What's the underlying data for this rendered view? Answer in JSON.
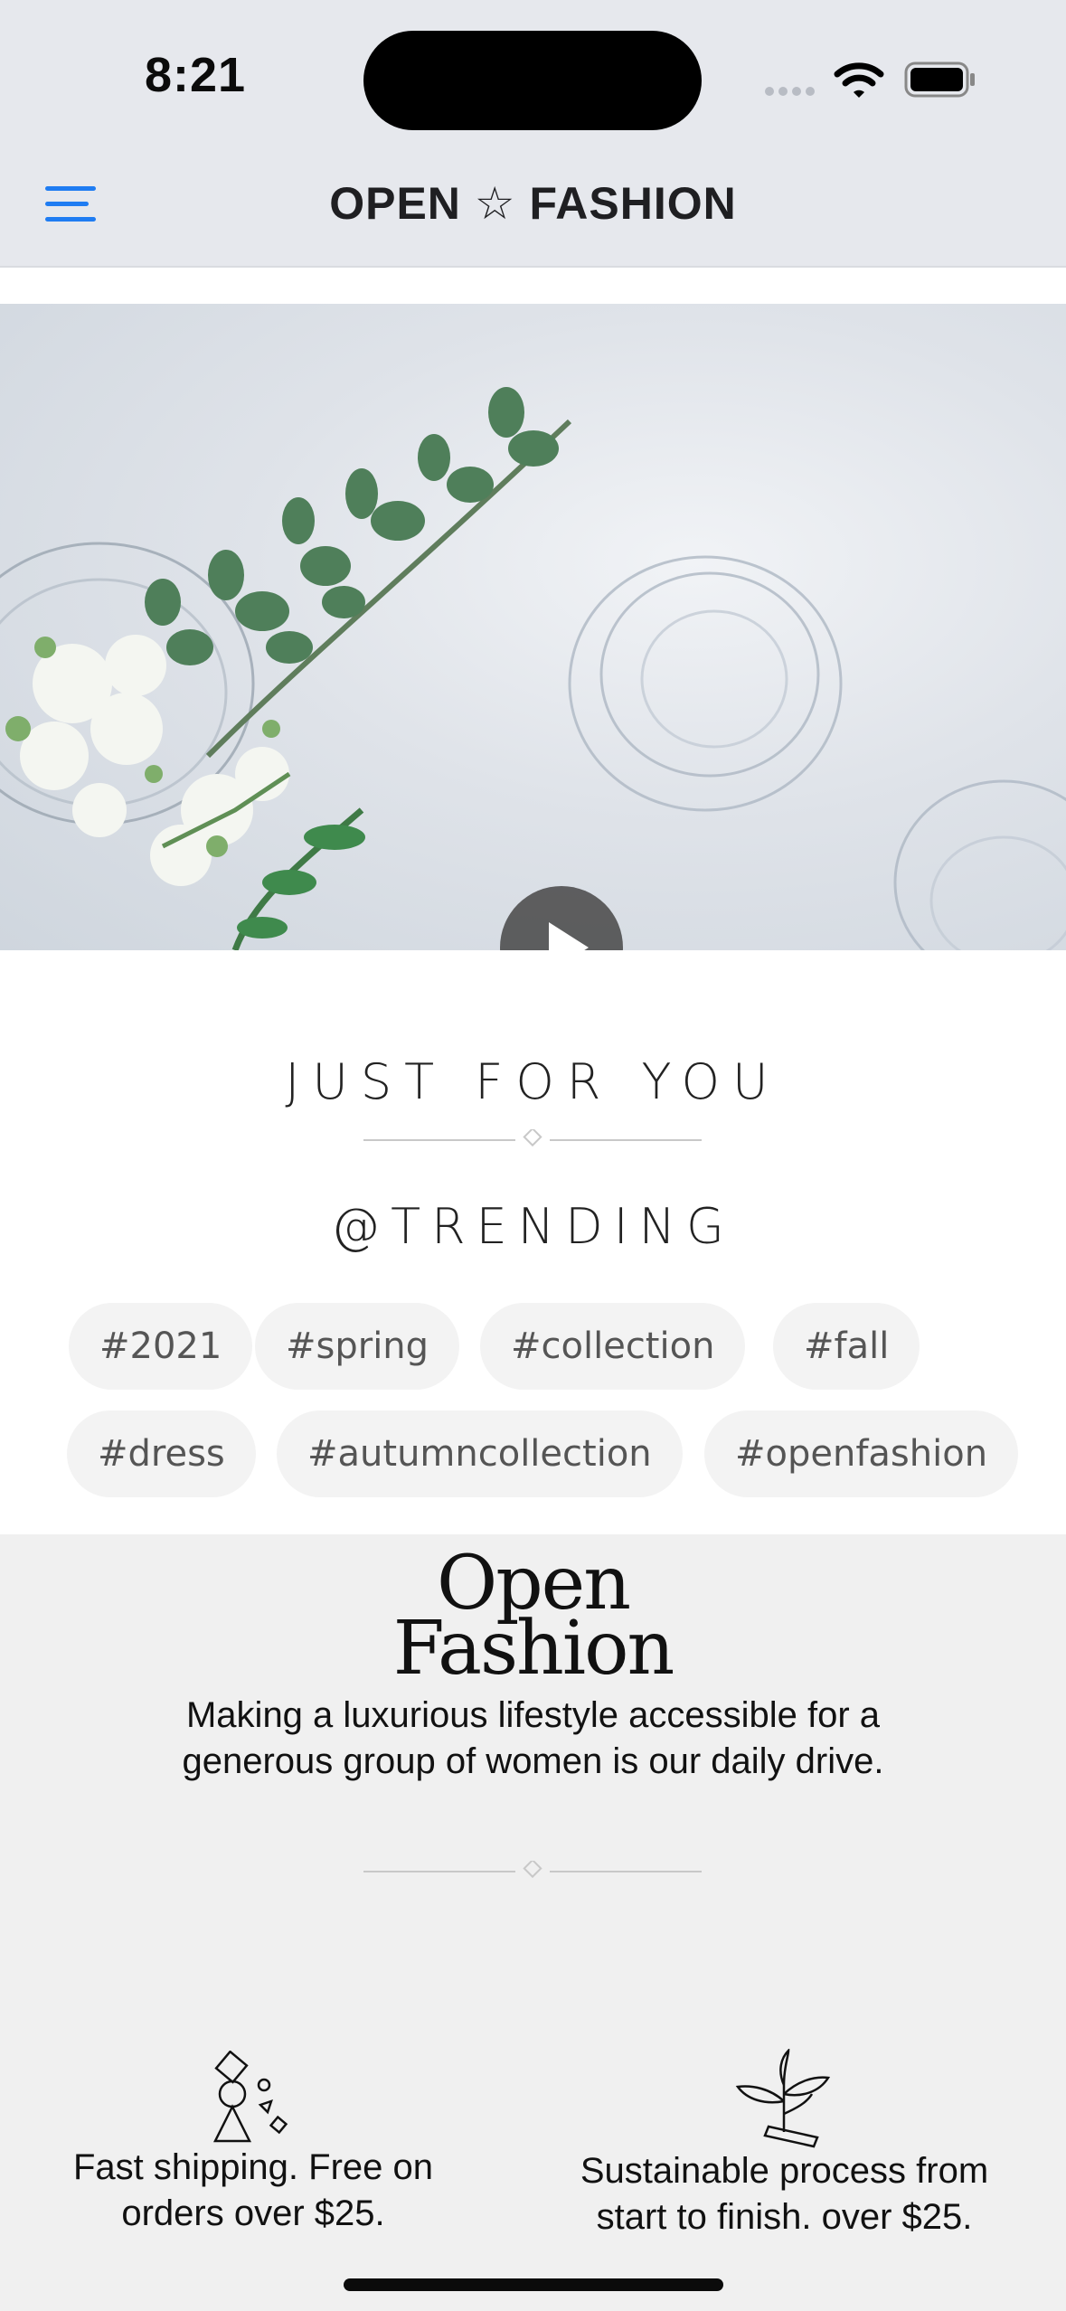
{
  "status_bar": {
    "time": "8:21"
  },
  "header": {
    "title": "OPEN ☆ FASHION",
    "menu_icon": "hamburger-menu-icon"
  },
  "hero": {
    "play_icon": "play-icon"
  },
  "sections": {
    "just_for_you": "JUST FOR YOU",
    "trending": "@TRENDING"
  },
  "tags": [
    "#2021",
    "#spring",
    "#collection",
    "#fall",
    "#dress",
    "#autumncollection",
    "#openfashion"
  ],
  "footer": {
    "brand_line1": "Open",
    "brand_line2": "Fashion",
    "mission": "Making a luxurious lifestyle accessible for a generous group of women is our daily drive.",
    "features": [
      {
        "icon": "shapes-icon",
        "text": "Fast shipping. Free on orders over $25."
      },
      {
        "icon": "plant-icon",
        "text": "Sustainable process from start to finish. over $25."
      }
    ]
  },
  "colors": {
    "accent": "#1f7cf2",
    "header_bg": "#e6e8ed",
    "footer_bg": "#f0f0f0",
    "tag_bg": "#f3f3f3"
  }
}
